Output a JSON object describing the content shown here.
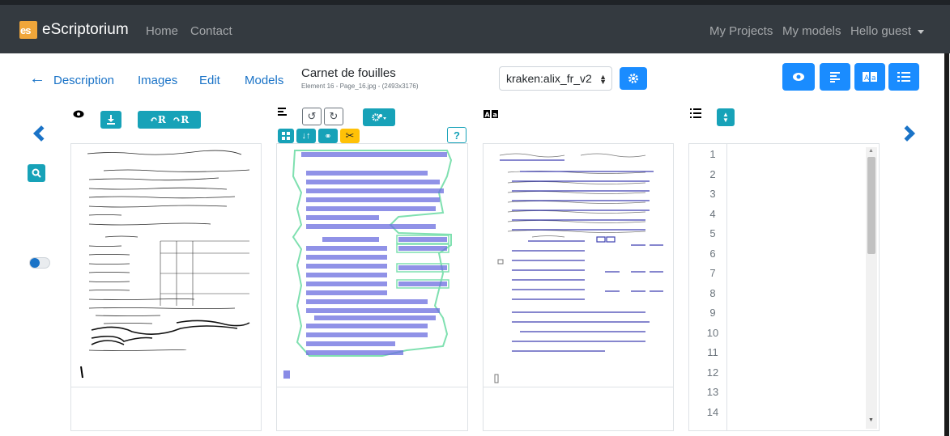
{
  "navbar": {
    "brand_logo": "es",
    "brand_name": "eScriptorium",
    "links": [
      "Home",
      "Contact"
    ],
    "right_links": [
      "My Projects",
      "My models"
    ],
    "user_menu": "Hello guest"
  },
  "toolbar": {
    "tabs": [
      "Description",
      "Images",
      "Edit",
      "Models"
    ],
    "document_title": "Carnet de fouilles",
    "document_subtitle": "Element 16 - Page_16.jpg - (2493x3176)",
    "model_select_value": "kraken:alix_fr_v2",
    "view_buttons": [
      "eye-icon",
      "segmentation-icon",
      "transcription-icon",
      "line-list-icon"
    ]
  },
  "panels": {
    "source": {
      "icon": "eye-icon",
      "rotate_left_label": "R",
      "rotate_right_label": "R"
    },
    "segmentation": {
      "icon": "segmentation-icon",
      "help_label": "?"
    },
    "transcription": {
      "icon": "transcription-icon"
    },
    "lines": {
      "icon": "line-list-icon",
      "numbers": [
        "1",
        "2",
        "3",
        "4",
        "5",
        "6",
        "7",
        "8",
        "9",
        "10",
        "11",
        "12",
        "13",
        "14"
      ]
    }
  },
  "colors": {
    "navbar_bg": "#343a40",
    "primary": "#1a8cff",
    "teal": "#17a2b8",
    "yellow": "#ffc107",
    "segment_line": "#6b6ee0",
    "segment_region": "#7fe0b0"
  }
}
